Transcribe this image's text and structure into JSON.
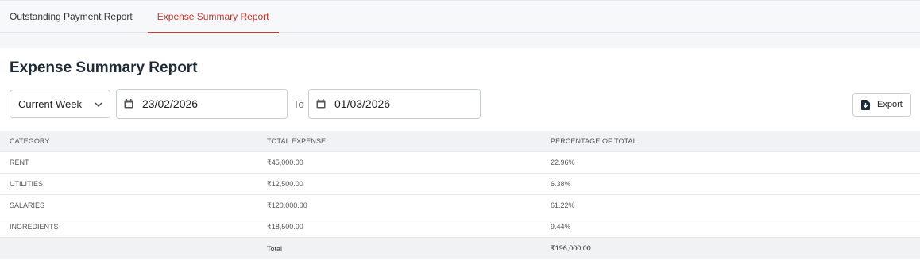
{
  "tabs": [
    {
      "label": "Outstanding Payment Report",
      "active": false
    },
    {
      "label": "Expense Summary Report",
      "active": true
    }
  ],
  "page_title": "Expense Summary Report",
  "filters": {
    "range_select": "Current Week",
    "from_date": "23/02/2026",
    "to_label": "To",
    "to_date": "01/03/2026"
  },
  "export_label": "Export",
  "table": {
    "headers": [
      "CATEGORY",
      "TOTAL EXPENSE",
      "PERCENTAGE OF TOTAL"
    ],
    "rows": [
      [
        "RENT",
        "₹45,000.00",
        "22.96%"
      ],
      [
        "UTILITIES",
        "₹12,500.00",
        "6.38%"
      ],
      [
        "SALARIES",
        "₹120,000.00",
        "61.22%"
      ],
      [
        "INGREDIENTS",
        "₹18,500.00",
        "9.44%"
      ]
    ],
    "total": {
      "label": "Total",
      "value": "₹196,000.00"
    }
  },
  "colors": {
    "accent": "#d0342c",
    "header_bg": "#f1f2f4"
  },
  "icons": {
    "calendar": "calendar-icon",
    "export": "file-download-icon",
    "dropdown": "chevron-down-icon"
  }
}
